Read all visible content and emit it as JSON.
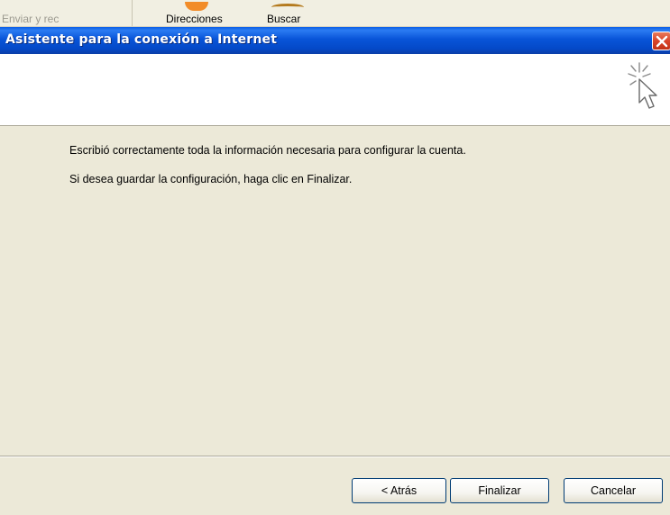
{
  "background_toolbar": {
    "items": [
      "Enviar y rec",
      "Direcciones",
      "Buscar"
    ]
  },
  "dialog": {
    "title": "Asistente para la conexión a Internet",
    "close_icon": "close-icon",
    "banner_icon": "wizard-cursor-icon",
    "message_line1": "Escribió correctamente toda la información necesaria para configurar la cuenta.",
    "message_line2": "Si desea guardar la configuración, haga clic en Finalizar.",
    "buttons": {
      "back": "< Atrás",
      "finish": "Finalizar",
      "cancel": "Cancelar"
    }
  },
  "colors": {
    "titlebar": "#0854d8",
    "close_button": "#d9452a",
    "dialog_face": "#ece9d8"
  }
}
